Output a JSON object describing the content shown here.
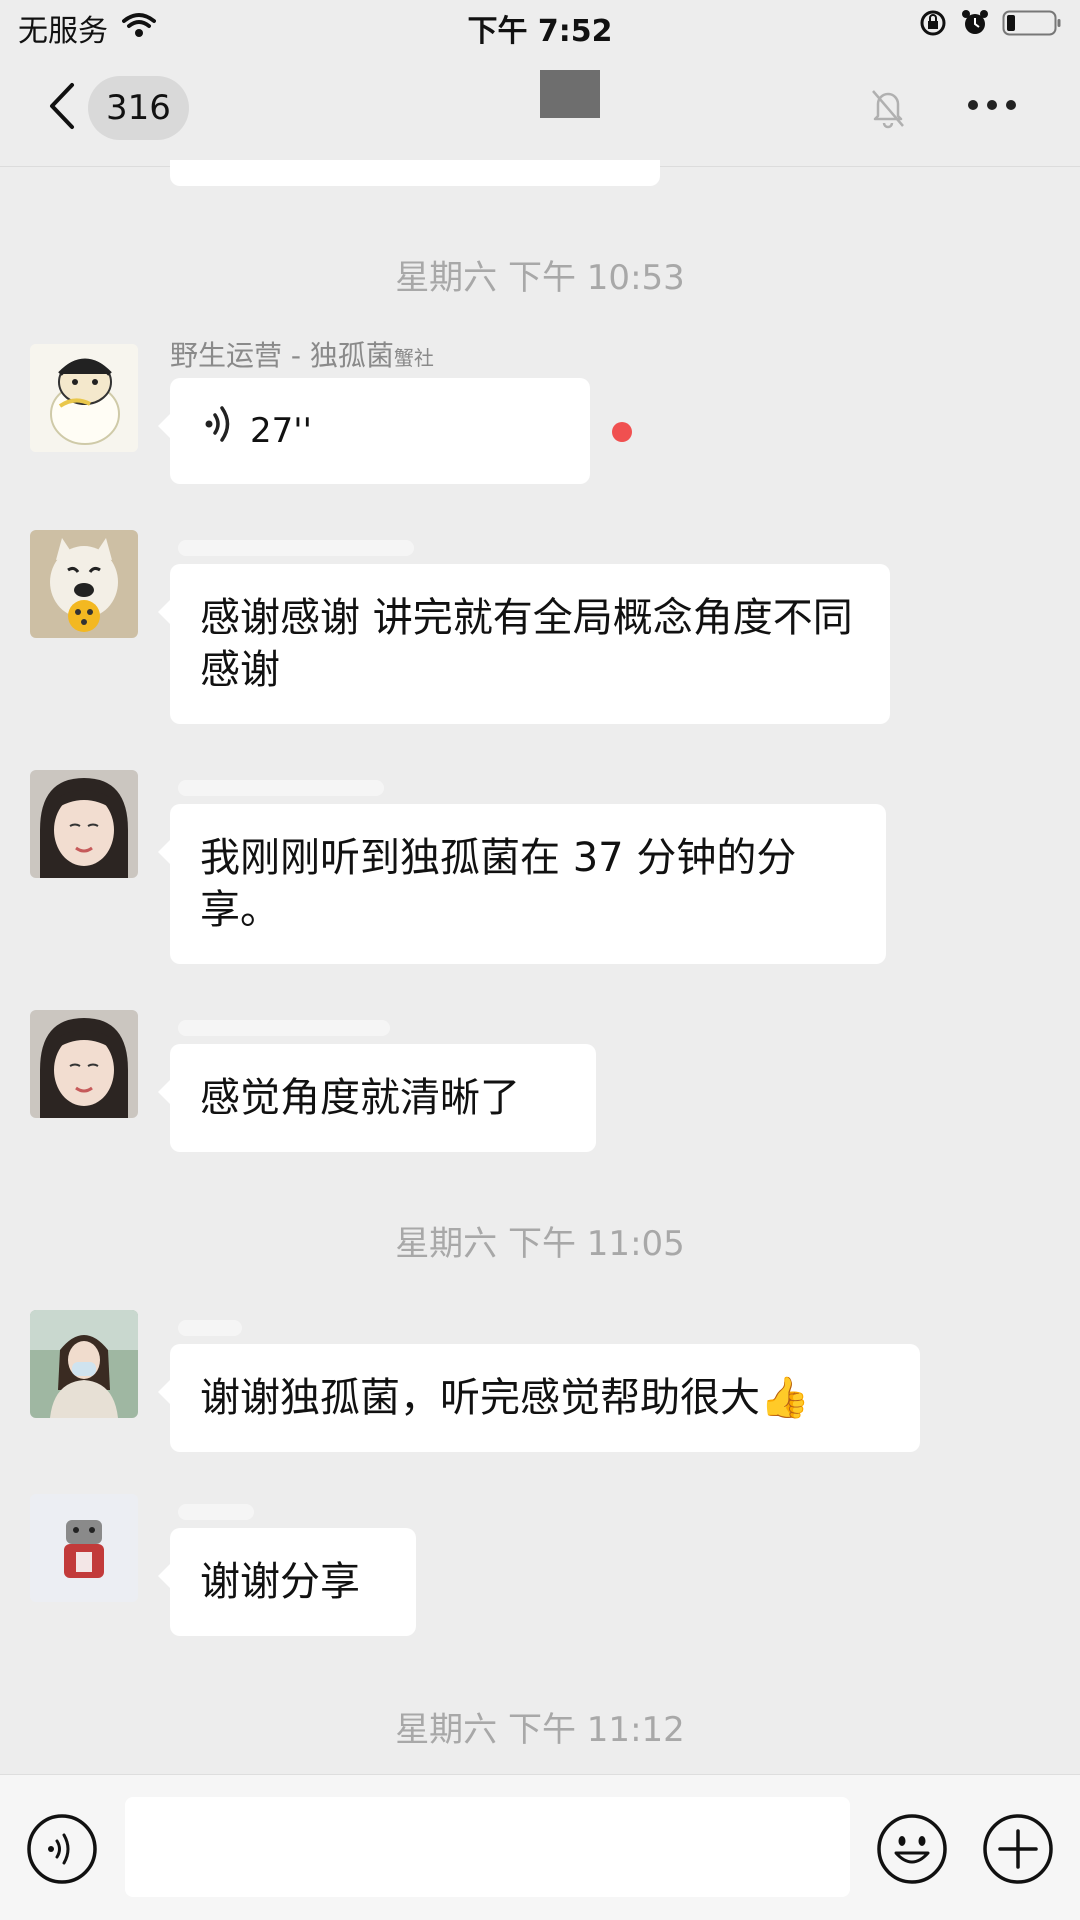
{
  "status_bar": {
    "carrier": "无服务",
    "time": "下午 7:52"
  },
  "nav": {
    "back_count": "316"
  },
  "chat": {
    "timestamps": [
      "星期六 下午 10:53",
      "星期六 下午 11:05",
      "星期六 下午 11:12"
    ],
    "messages": [
      {
        "nickname": "野生运营 - 独孤菌",
        "nickname_badge": "蟹社",
        "voice_duration": "27''"
      },
      {
        "text": "感谢感谢  讲完就有全局概念角度不同 感谢"
      },
      {
        "text": "我刚刚听到独孤菌在 37 分钟的分享。"
      },
      {
        "text": "感觉角度就清晰了"
      },
      {
        "text": "谢谢独孤菌，听完感觉帮助很大👍"
      },
      {
        "text": "谢谢分享"
      }
    ]
  },
  "input_bar": {
    "icons": [
      "voice-icon",
      "emoji-icon",
      "plus-icon"
    ]
  },
  "colors": {
    "background": "#ededed",
    "bubble": "#ffffff",
    "unread_dot": "#f05050",
    "timestamp": "#a8a8a8"
  }
}
